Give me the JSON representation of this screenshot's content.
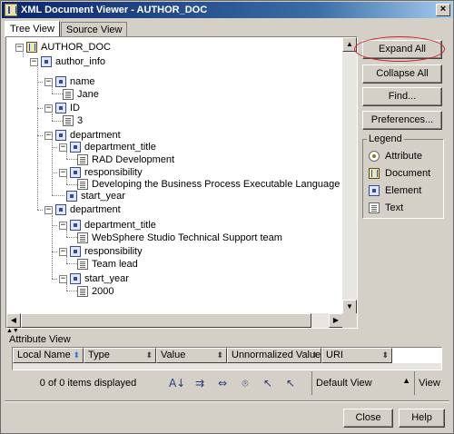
{
  "window": {
    "title": "XML Document Viewer - AUTHOR_DOC",
    "close_glyph": "×"
  },
  "tabs": [
    {
      "label": "Tree View",
      "active": true
    },
    {
      "label": "Source View",
      "active": false
    }
  ],
  "tree": {
    "nodes": [
      {
        "label": "AUTHOR_DOC",
        "icon": "document-icon",
        "expander": "−"
      },
      {
        "label": "author_info",
        "icon": "element-icon",
        "expander": "−"
      },
      {
        "label": "name",
        "icon": "element-icon",
        "expander": "−"
      },
      {
        "label": "Jane",
        "icon": "text-icon"
      },
      {
        "label": "ID",
        "icon": "element-icon",
        "expander": "−"
      },
      {
        "label": "3",
        "icon": "text-icon"
      },
      {
        "label": "department",
        "icon": "element-icon",
        "expander": "−"
      },
      {
        "label": "department_title",
        "icon": "element-icon",
        "expander": "−"
      },
      {
        "label": "RAD Development",
        "icon": "text-icon"
      },
      {
        "label": "responsibility",
        "icon": "element-icon",
        "expander": "−"
      },
      {
        "label": "Developing the Business Process Executable Language (BPEL",
        "icon": "text-icon"
      },
      {
        "label": "start_year",
        "icon": "element-icon",
        "expander": "+"
      },
      {
        "label": "department",
        "icon": "element-icon",
        "expander": "−"
      },
      {
        "label": "department_title",
        "icon": "element-icon",
        "expander": "−"
      },
      {
        "label": "WebSphere Studio Technical Support team",
        "icon": "text-icon"
      },
      {
        "label": "responsibility",
        "icon": "element-icon",
        "expander": "−"
      },
      {
        "label": "Team lead",
        "icon": "text-icon"
      },
      {
        "label": "start_year",
        "icon": "element-icon",
        "expander": "−"
      },
      {
        "label": "2000",
        "icon": "text-icon"
      }
    ]
  },
  "buttons": {
    "expand_all": "Expand All",
    "collapse_all": "Collapse All",
    "find": "Find...",
    "preferences": "Preferences..."
  },
  "legend": {
    "title": "Legend",
    "items": [
      {
        "label": "Attribute",
        "icon": "attribute-icon"
      },
      {
        "label": "Document",
        "icon": "document-icon"
      },
      {
        "label": "Element",
        "icon": "element-icon"
      },
      {
        "label": "Text",
        "icon": "text-icon"
      }
    ]
  },
  "attribute_view": {
    "title": "Attribute View",
    "columns": [
      "Local Name",
      "Type",
      "Value",
      "Unnormalized Value",
      "URI"
    ],
    "status": "0 of 0 items displayed",
    "view_select": "Default View",
    "view_button": "View"
  },
  "footer": {
    "close": "Close",
    "help": "Help"
  },
  "colors": {
    "highlight_oval": "#d02020",
    "title_bar": "#0a246a"
  }
}
